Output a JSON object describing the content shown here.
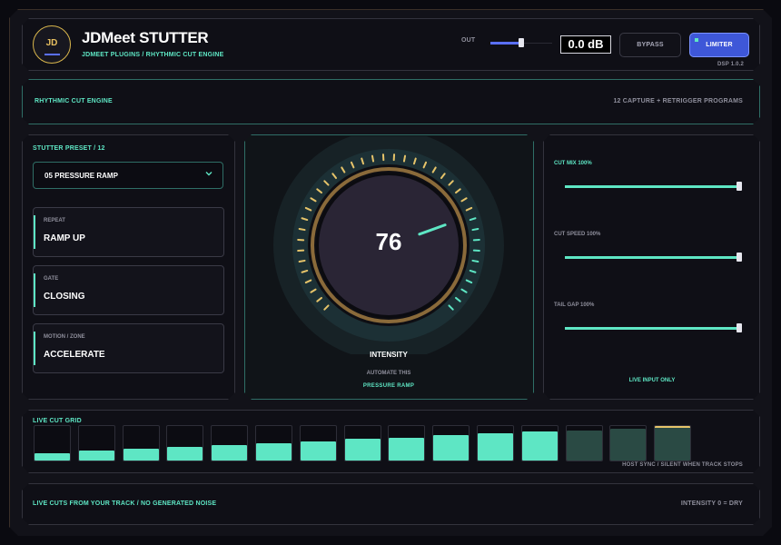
{
  "header": {
    "logo_text": "JD",
    "title": "JDMeet STUTTER",
    "subtitle": "JDmeet PLUGINS  /  RHYTHMIC CUT ENGINE",
    "out_label": "OUT",
    "out_level": 0.5,
    "out_readout": "0.0 dB",
    "bypass_label": "BYPASS",
    "limiter_label": "LIMITER",
    "version": "DSP 1.0.2"
  },
  "info_strip": {
    "left": "RHYTHMIC CUT ENGINE",
    "right": "12 CAPTURE + RETRIGGER PROGRAMS"
  },
  "preset": {
    "label": "STUTTER PRESET  /  12",
    "selected": "05  PRESSURE RAMP"
  },
  "params": [
    {
      "label": "REPEAT",
      "value": "RAMP UP"
    },
    {
      "label": "GATE",
      "value": "CLOSING"
    },
    {
      "label": "MOTION / ZONE",
      "value": "ACCELERATE"
    }
  ],
  "knob": {
    "value": "76",
    "title": "INTENSITY",
    "automate": "AUTOMATE THIS",
    "preset_name": "PRESSURE RAMP"
  },
  "sliders": [
    {
      "label": "CUT MIX  100%",
      "value": 1.0
    },
    {
      "label": "CUT SPEED  100%",
      "value": 1.0
    },
    {
      "label": "TAIL GAP  100%",
      "value": 1.0
    }
  ],
  "live_only": "LIVE INPUT ONLY",
  "grid": {
    "label": "LIVE CUT GRID",
    "steps": [
      0.22,
      0.28,
      0.34,
      0.4,
      0.45,
      0.5,
      0.56,
      0.62,
      0.67,
      0.73,
      0.79,
      0.85,
      0.88,
      0.92,
      0.96
    ],
    "active_steps": 12,
    "footer": "HOST SYNC  /  SILENT WHEN TRACK STOPS"
  },
  "footer": {
    "left": "LIVE CUTS FROM YOUR TRACK  /  NO GENERATED NOISE",
    "right": "INTENSITY 0 = DRY"
  },
  "colors": {
    "accent": "#5ee6c4",
    "accent_dim": "#2a4a44",
    "blue": "#3e57d8",
    "gold": "#d9b64c",
    "ring": "#8a6a3a"
  }
}
